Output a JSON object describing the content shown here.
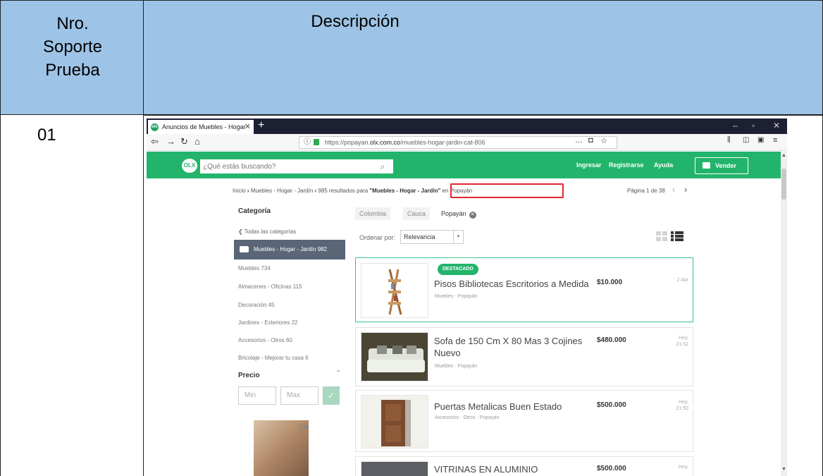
{
  "table": {
    "header_left": [
      "Nro.",
      "Soporte",
      "Prueba"
    ],
    "header_right": "Descripción",
    "row_number": "01"
  },
  "browser": {
    "tab_title": "Anuncios de Muebles - Hogar",
    "url_prefix": "https://popayan.",
    "url_host": "olx.com.co",
    "url_path": "/muebles-hogar-jardin-cat-806",
    "menu_dots": "…"
  },
  "olx": {
    "logo": "OLX",
    "search_placeholder": "¿Qué estás buscando?",
    "nav": {
      "ingresar": "Ingresar",
      "registrarse": "Registrarse",
      "ayuda": "Ayuda",
      "vender": "Vender"
    },
    "breadcrumb": {
      "inicio": "Inicio",
      "category": "Muebles - Hogar - Jardín",
      "results_prefix": "985 resultados para ",
      "results_query": "\"Muebles - Hogar - Jardín\"",
      "results_suffix": " en Popayán"
    },
    "pagination": "Página 1 de 38",
    "sidebar": {
      "title": "Categoría",
      "back": "Todas las categorías",
      "active": "Muebles - Hogar - Jardín 982",
      "items": [
        "Muebles 734",
        "Almacenes - Oficinas 115",
        "Decoración 45",
        "Jardines - Exteriores 22",
        "Accesorios - Otros 60",
        "Bricolaje - Mejorar tu casa 6"
      ],
      "price_title": "Precio",
      "min_placeholder": "Min",
      "max_placeholder": "Max",
      "ad_badge": "ⓘ✕"
    },
    "location_chips": [
      "Colombia",
      "Cauca",
      "Popayán"
    ],
    "sort": {
      "label": "Ordenar por:",
      "value": "Relevancia"
    },
    "listings": [
      {
        "badge": "DESTACADO",
        "title": "Pisos Bibliotecas Escritorios a Medida",
        "subtitle": "Muebles - Popayán",
        "price": "$10.000",
        "date": "2 Abr"
      },
      {
        "title": "Sofa de 150 Cm X 80 Mas 3 Cojines Nuevo",
        "subtitle": "Muebles - Popayán",
        "price": "$480.000",
        "date": "Hoy,",
        "time": "21:52"
      },
      {
        "title": "Puertas Metalicas Buen Estado",
        "subtitle": "Accesorios - Otros - Popayán",
        "price": "$500.000",
        "date": "Hoy,",
        "time": "21:50"
      },
      {
        "title": "VITRINAS EN ALUMINIO",
        "price": "$500.000",
        "date": "Hoy,"
      }
    ]
  },
  "colors": {
    "table_header": "#9dc3e6",
    "olx_green": "#23b46b",
    "highlight_red": "#e3252b",
    "titlebar": "#1d1f33"
  }
}
